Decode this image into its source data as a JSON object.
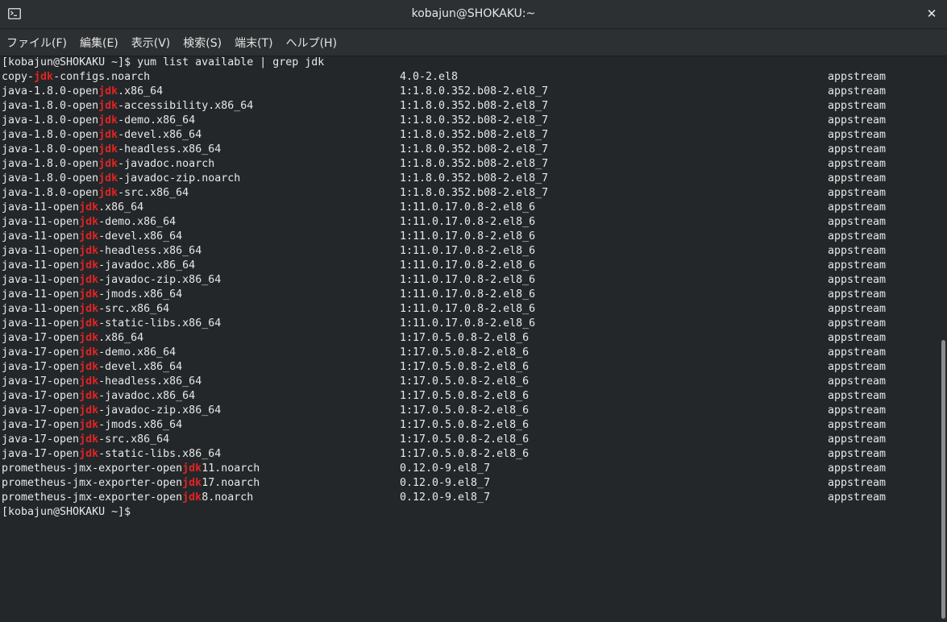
{
  "window": {
    "title": "kobajun@SHOKAKU:~",
    "close_glyph": "✕"
  },
  "menu": [
    {
      "label": "ファイル(F)"
    },
    {
      "label": "編集(E)"
    },
    {
      "label": "表示(V)"
    },
    {
      "label": "検索(S)"
    },
    {
      "label": "端末(T)"
    },
    {
      "label": "ヘルプ(H)"
    }
  ],
  "terminal": {
    "command_prompt": "[kobajun@SHOKAKU ~]$ yum list available | grep jdk",
    "final_prompt": "[kobajun@SHOKAKU ~]$",
    "highlight": "jdk",
    "rows": [
      {
        "pre": "copy-",
        "post": "-configs.noarch",
        "version": "4.0-2.el8",
        "repo": "appstream"
      },
      {
        "pre": "java-1.8.0-open",
        "post": ".x86_64",
        "version": "1:1.8.0.352.b08-2.el8_7",
        "repo": "appstream"
      },
      {
        "pre": "java-1.8.0-open",
        "post": "-accessibility.x86_64",
        "version": "1:1.8.0.352.b08-2.el8_7",
        "repo": "appstream"
      },
      {
        "pre": "java-1.8.0-open",
        "post": "-demo.x86_64",
        "version": "1:1.8.0.352.b08-2.el8_7",
        "repo": "appstream"
      },
      {
        "pre": "java-1.8.0-open",
        "post": "-devel.x86_64",
        "version": "1:1.8.0.352.b08-2.el8_7",
        "repo": "appstream"
      },
      {
        "pre": "java-1.8.0-open",
        "post": "-headless.x86_64",
        "version": "1:1.8.0.352.b08-2.el8_7",
        "repo": "appstream"
      },
      {
        "pre": "java-1.8.0-open",
        "post": "-javadoc.noarch",
        "version": "1:1.8.0.352.b08-2.el8_7",
        "repo": "appstream"
      },
      {
        "pre": "java-1.8.0-open",
        "post": "-javadoc-zip.noarch",
        "version": "1:1.8.0.352.b08-2.el8_7",
        "repo": "appstream"
      },
      {
        "pre": "java-1.8.0-open",
        "post": "-src.x86_64",
        "version": "1:1.8.0.352.b08-2.el8_7",
        "repo": "appstream"
      },
      {
        "pre": "java-11-open",
        "post": ".x86_64",
        "version": "1:11.0.17.0.8-2.el8_6",
        "repo": "appstream"
      },
      {
        "pre": "java-11-open",
        "post": "-demo.x86_64",
        "version": "1:11.0.17.0.8-2.el8_6",
        "repo": "appstream"
      },
      {
        "pre": "java-11-open",
        "post": "-devel.x86_64",
        "version": "1:11.0.17.0.8-2.el8_6",
        "repo": "appstream"
      },
      {
        "pre": "java-11-open",
        "post": "-headless.x86_64",
        "version": "1:11.0.17.0.8-2.el8_6",
        "repo": "appstream"
      },
      {
        "pre": "java-11-open",
        "post": "-javadoc.x86_64",
        "version": "1:11.0.17.0.8-2.el8_6",
        "repo": "appstream"
      },
      {
        "pre": "java-11-open",
        "post": "-javadoc-zip.x86_64",
        "version": "1:11.0.17.0.8-2.el8_6",
        "repo": "appstream"
      },
      {
        "pre": "java-11-open",
        "post": "-jmods.x86_64",
        "version": "1:11.0.17.0.8-2.el8_6",
        "repo": "appstream"
      },
      {
        "pre": "java-11-open",
        "post": "-src.x86_64",
        "version": "1:11.0.17.0.8-2.el8_6",
        "repo": "appstream"
      },
      {
        "pre": "java-11-open",
        "post": "-static-libs.x86_64",
        "version": "1:11.0.17.0.8-2.el8_6",
        "repo": "appstream"
      },
      {
        "pre": "java-17-open",
        "post": ".x86_64",
        "version": "1:17.0.5.0.8-2.el8_6",
        "repo": "appstream"
      },
      {
        "pre": "java-17-open",
        "post": "-demo.x86_64",
        "version": "1:17.0.5.0.8-2.el8_6",
        "repo": "appstream"
      },
      {
        "pre": "java-17-open",
        "post": "-devel.x86_64",
        "version": "1:17.0.5.0.8-2.el8_6",
        "repo": "appstream"
      },
      {
        "pre": "java-17-open",
        "post": "-headless.x86_64",
        "version": "1:17.0.5.0.8-2.el8_6",
        "repo": "appstream"
      },
      {
        "pre": "java-17-open",
        "post": "-javadoc.x86_64",
        "version": "1:17.0.5.0.8-2.el8_6",
        "repo": "appstream"
      },
      {
        "pre": "java-17-open",
        "post": "-javadoc-zip.x86_64",
        "version": "1:17.0.5.0.8-2.el8_6",
        "repo": "appstream"
      },
      {
        "pre": "java-17-open",
        "post": "-jmods.x86_64",
        "version": "1:17.0.5.0.8-2.el8_6",
        "repo": "appstream"
      },
      {
        "pre": "java-17-open",
        "post": "-src.x86_64",
        "version": "1:17.0.5.0.8-2.el8_6",
        "repo": "appstream"
      },
      {
        "pre": "java-17-open",
        "post": "-static-libs.x86_64",
        "version": "1:17.0.5.0.8-2.el8_6",
        "repo": "appstream"
      },
      {
        "pre": "prometheus-jmx-exporter-open",
        "post": "11.noarch",
        "version": "0.12.0-9.el8_7",
        "repo": "appstream"
      },
      {
        "pre": "prometheus-jmx-exporter-open",
        "post": "17.noarch",
        "version": "0.12.0-9.el8_7",
        "repo": "appstream"
      },
      {
        "pre": "prometheus-jmx-exporter-open",
        "post": "8.noarch",
        "version": "0.12.0-9.el8_7",
        "repo": "appstream"
      }
    ]
  },
  "colors": {
    "background": "#232729",
    "text": "#e8e8e8",
    "highlight": "#e02424",
    "chrome": "#2d3032"
  },
  "icons": {
    "app": "terminal-icon",
    "close": "close-icon"
  }
}
